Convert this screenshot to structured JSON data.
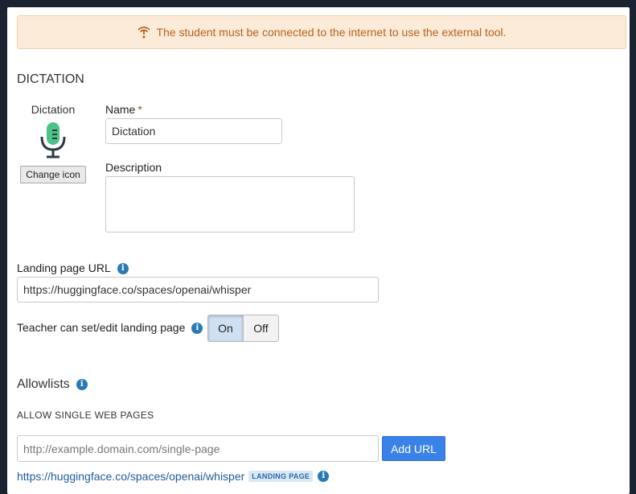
{
  "banner": {
    "icon": "wifi-warning-icon",
    "text": "The student must be connected to the internet to use the external tool."
  },
  "section_title": "DICTATION",
  "tool": {
    "icon_label": "Dictation",
    "icon": "microphone-icon",
    "change_icon_label": "Change icon",
    "name_label": "Name",
    "required_mark": "*",
    "name_value": "Dictation",
    "description_label": "Description",
    "description_value": ""
  },
  "landing": {
    "label": "Landing page URL",
    "info_icon": "info-icon",
    "value": "https://huggingface.co/spaces/openai/whisper"
  },
  "teacher_edit": {
    "label": "Teacher can set/edit landing page",
    "on_label": "On",
    "off_label": "Off",
    "selected": "On"
  },
  "allowlists": {
    "title": "Allowlists",
    "single_pages_title": "ALLOW SINGLE WEB PAGES",
    "input_placeholder": "http://example.domain.com/single-page",
    "add_button": "Add URL",
    "entries": [
      {
        "url": "https://huggingface.co/spaces/openai/whisper",
        "badge": "LANDING PAGE"
      }
    ]
  },
  "colors": {
    "accent": "#3b82e8",
    "banner_bg": "#fcebd9",
    "banner_text": "#b5621c",
    "info": "#2a7ab8",
    "mic_green": "#4cc487"
  }
}
